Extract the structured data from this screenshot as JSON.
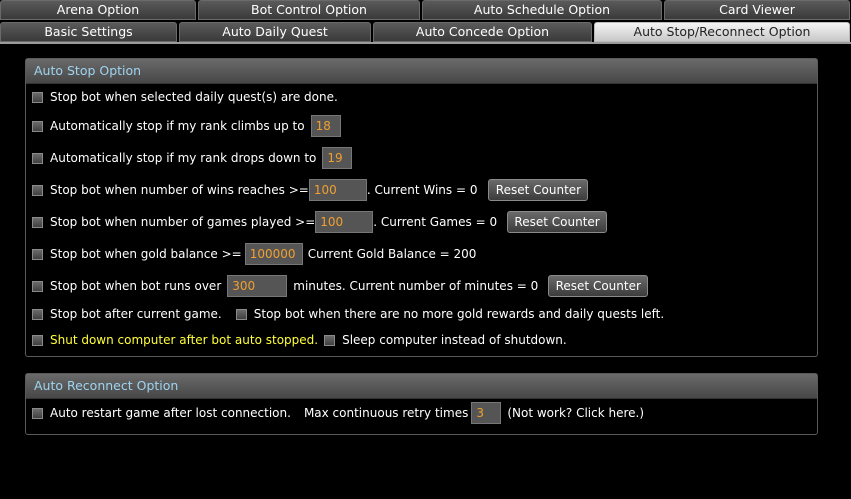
{
  "tabs_row1": [
    {
      "label": "Arena Option"
    },
    {
      "label": "Bot Control Option"
    },
    {
      "label": "Auto Schedule Option"
    },
    {
      "label": "Card Viewer"
    }
  ],
  "tabs_row2": [
    {
      "label": "Basic Settings"
    },
    {
      "label": "Auto Daily Quest"
    },
    {
      "label": "Auto Concede Option"
    },
    {
      "label": "Auto Stop/Reconnect Option"
    }
  ],
  "auto_stop": {
    "title": "Auto Stop Option",
    "quest_done": "Stop bot when selected daily quest(s) are done.",
    "rank_climb_label": "Automatically stop if my rank climbs up to",
    "rank_climb_value": "18",
    "rank_drop_label": "Automatically stop if my rank drops down to",
    "rank_drop_value": "19",
    "wins_label": "Stop bot when number of wins reaches >=",
    "wins_value": "100",
    "wins_current": ". Current Wins = 0",
    "games_label": "Stop bot when number of games played >=",
    "games_value": "100",
    "games_current": ". Current Games = 0",
    "gold_label": "Stop bot when gold balance >=",
    "gold_value": "100000",
    "gold_current": "Current Gold Balance = 200",
    "runs_label": "Stop bot when bot runs over",
    "runs_value": "300",
    "runs_current": "minutes. Current number of minutes = 0",
    "reset_label": "Reset Counter",
    "after_game": "Stop bot after current game.",
    "no_gold": "Stop bot when there are no more gold rewards and daily quests left.",
    "shutdown": "Shut down computer after bot auto stopped.",
    "sleep": "Sleep computer instead of shutdown."
  },
  "auto_reconnect": {
    "title": "Auto Reconnect Option",
    "restart_label": "Auto restart game after lost connection.",
    "retry_label": "Max continuous retry times",
    "retry_value": "3",
    "not_work": "(Not work? Click here.)"
  }
}
